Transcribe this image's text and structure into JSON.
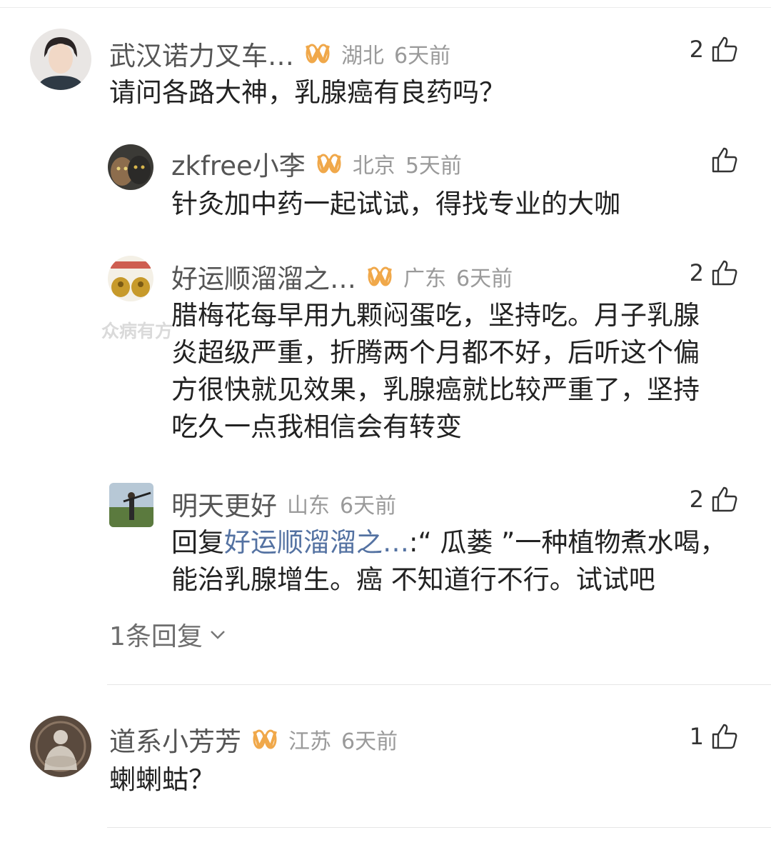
{
  "comments": [
    {
      "name": "武汉诺力叉车…",
      "location": "湖北",
      "time": "6天前",
      "likes": "2",
      "text": "请问各路大神，乳腺癌有良药吗？",
      "replies": [
        {
          "name": "zkfree小李",
          "location": "北京",
          "time": "5天前",
          "likes": "",
          "text": "针灸加中药一起试试，得找专业的大咖"
        },
        {
          "name": "好运顺溜溜之…",
          "location": "广东",
          "time": "6天前",
          "likes": "2",
          "text_lines": [
            "腊梅花每早用九颗闷蛋吃，坚持吃。月子乳腺",
            "炎超级严重，折腾两个月都不好，后听这个偏",
            "方很快就见效果，乳腺癌就比较严重了，坚持",
            "吃久一点我相信会有转变"
          ]
        },
        {
          "name": "明天更好",
          "location": "山东",
          "time": "6天前",
          "likes": "2",
          "reply_prefix": "回复",
          "reply_target": "好运顺溜溜之…",
          "text_line1": ":“ 瓜蒌 ”一种植物煮水喝，",
          "text_line2": "能治乳腺增生。癌 不知道行不行。试试吧"
        }
      ],
      "more_replies": "1条回复"
    },
    {
      "name": "道系小芳芳",
      "location": "江苏",
      "time": "6天前",
      "likes": "1",
      "text": "蝲蝲蛄？"
    }
  ],
  "watermark": "众病有方",
  "colors": {
    "vip_badge": "#f0a84a",
    "reply_link": "#5472a2",
    "name": "#555555",
    "meta": "#9a9a9a"
  },
  "icons": [
    "thumb-up-icon",
    "vip-badge-icon",
    "chevron-down-icon"
  ]
}
